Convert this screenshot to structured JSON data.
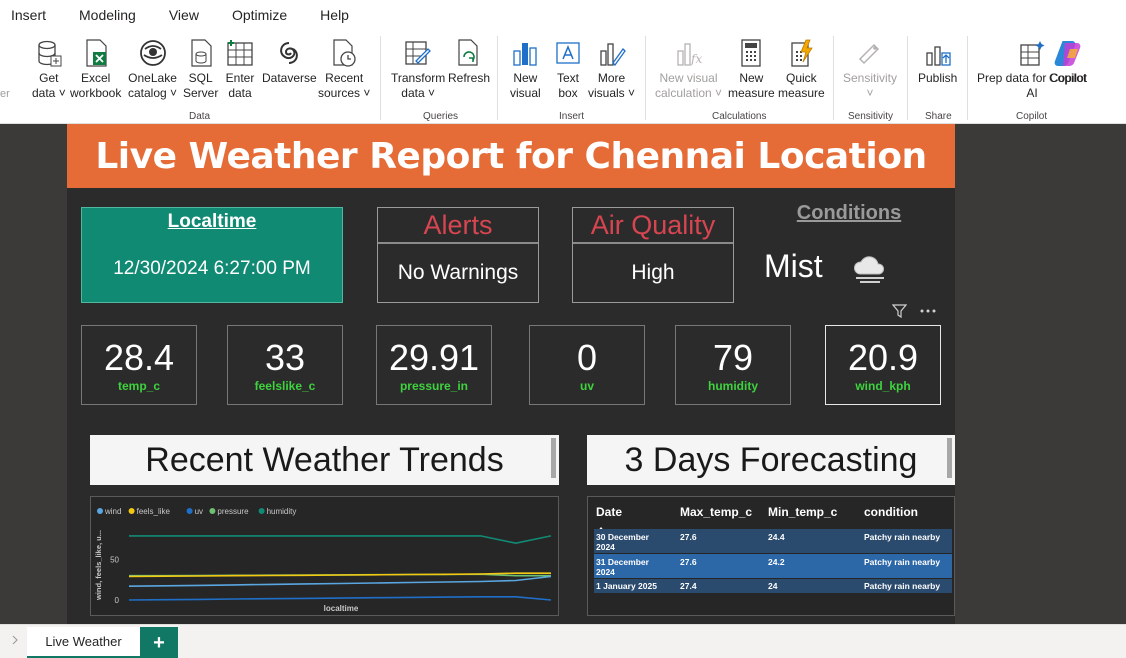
{
  "menu": [
    "Insert",
    "Modeling",
    "View",
    "Optimize",
    "Help"
  ],
  "ribbon": {
    "buttons": [
      {
        "line1": "Get",
        "line2": "data ˅",
        "icon": "database-icon"
      },
      {
        "line1": "Excel",
        "line2": "workbook",
        "icon": "excel-icon"
      },
      {
        "line1": "OneLake",
        "line2": "catalog ˅",
        "icon": "onelake-icon"
      },
      {
        "line1": "SQL",
        "line2": "Server",
        "icon": "sql-server-icon"
      },
      {
        "line1": "Enter",
        "line2": "data",
        "icon": "table-icon"
      },
      {
        "line1": "Dataverse",
        "line2": "",
        "icon": "dataverse-icon"
      },
      {
        "line1": "Recent",
        "line2": "sources ˅",
        "icon": "recent-sources-icon"
      },
      {
        "line1": "Transform",
        "line2": "data ˅",
        "icon": "transform-icon"
      },
      {
        "line1": "Refresh",
        "line2": "",
        "icon": "refresh-icon"
      },
      {
        "line1": "New",
        "line2": "visual",
        "icon": "bar-chart-icon"
      },
      {
        "line1": "Text",
        "line2": "box",
        "icon": "text-box-icon"
      },
      {
        "line1": "More",
        "line2": "visuals ˅",
        "icon": "more-visuals-icon"
      },
      {
        "line1": "New visual",
        "line2": "calculation ˅",
        "icon": "fx-icon"
      },
      {
        "line1": "New",
        "line2": "measure",
        "icon": "calculator-icon"
      },
      {
        "line1": "Quick",
        "line2": "measure",
        "icon": "quick-measure-icon"
      },
      {
        "line1": "Sensitivity",
        "line2": "˅",
        "icon": "sensitivity-icon"
      },
      {
        "line1": "Publish",
        "line2": "",
        "icon": "publish-icon"
      },
      {
        "line1": "Prep data for Copilot",
        "line2": "AI",
        "icon": "prep-data-icon"
      },
      {
        "line1": "Copilot",
        "line2": "",
        "icon": "copilot-icon"
      }
    ],
    "groups": [
      "Data",
      "Queries",
      "Insert",
      "Calculations",
      "Sensitivity",
      "Share",
      "Copilot"
    ],
    "left_edge_label": "er"
  },
  "report": {
    "title": "Live Weather Report for Chennai Location",
    "localtime_title": "Localtime",
    "localtime_value": "12/30/2024 6:27:00 PM",
    "alerts_title": "Alerts",
    "alerts_value": "No Warnings",
    "airq_title": "Air Quality",
    "airq_value": "High",
    "conditions_title": "Conditions",
    "conditions_value": "Mist",
    "kpis": [
      {
        "value": "28.4",
        "label": "temp_c"
      },
      {
        "value": "33",
        "label": "feelslike_c"
      },
      {
        "value": "29.91",
        "label": "pressure_in"
      },
      {
        "value": "0",
        "label": "uv"
      },
      {
        "value": "79",
        "label": "humidity"
      },
      {
        "value": "20.9",
        "label": "wind_kph"
      }
    ],
    "trends_title": "Recent Weather Trends",
    "forecast_title": "3 Days Forecasting"
  },
  "chart_data": {
    "type": "line",
    "legend": [
      "wind",
      "feels_like",
      "uv",
      "pressure",
      "humidity"
    ],
    "legend_colors": [
      "#5aa6e0",
      "#f2c811",
      "#1f6fc8",
      "#6fbf73",
      "#118a74"
    ],
    "ylabel": "wind, feels_like, u...",
    "xlabel": "localtime",
    "yticks": [
      "50",
      "0"
    ],
    "ylim": [
      0,
      90
    ],
    "series": [
      {
        "name": "humidity",
        "values": [
          79,
          79,
          79,
          79,
          79,
          79,
          79,
          79,
          79,
          79,
          79,
          70,
          79
        ]
      },
      {
        "name": "pressure",
        "values": [
          30,
          30,
          30.2,
          30.4,
          30.6,
          30.8,
          31,
          31.2,
          31.4,
          31.6,
          31.8,
          30,
          30
        ]
      },
      {
        "name": "feels_like",
        "values": [
          29,
          29.3,
          29.6,
          29.9,
          30.2,
          30.5,
          30.8,
          31.1,
          31.4,
          31.7,
          32,
          33,
          33
        ]
      },
      {
        "name": "wind",
        "values": [
          17,
          17.5,
          18,
          18.6,
          19.2,
          19.8,
          20.4,
          21,
          21.6,
          22.2,
          22.8,
          24,
          29
        ]
      },
      {
        "name": "uv",
        "values": [
          0,
          0.4,
          0.8,
          1.2,
          1.6,
          2,
          2.4,
          2.8,
          3.2,
          3.6,
          4,
          4,
          0
        ]
      }
    ]
  },
  "forecast": {
    "headers": [
      "Date",
      "Max_temp_c",
      "Min_temp_c",
      "condition"
    ],
    "rows": [
      {
        "date": "30 December 2024",
        "max": "27.6",
        "min": "24.4",
        "cond": "Patchy rain nearby"
      },
      {
        "date": "31 December 2024",
        "max": "27.6",
        "min": "24.2",
        "cond": "Patchy rain nearby"
      },
      {
        "date": "1 January 2025",
        "max": "27.4",
        "min": "24",
        "cond": "Patchy rain nearby"
      }
    ]
  },
  "tabs": {
    "active": "Live Weather",
    "add": "+"
  }
}
